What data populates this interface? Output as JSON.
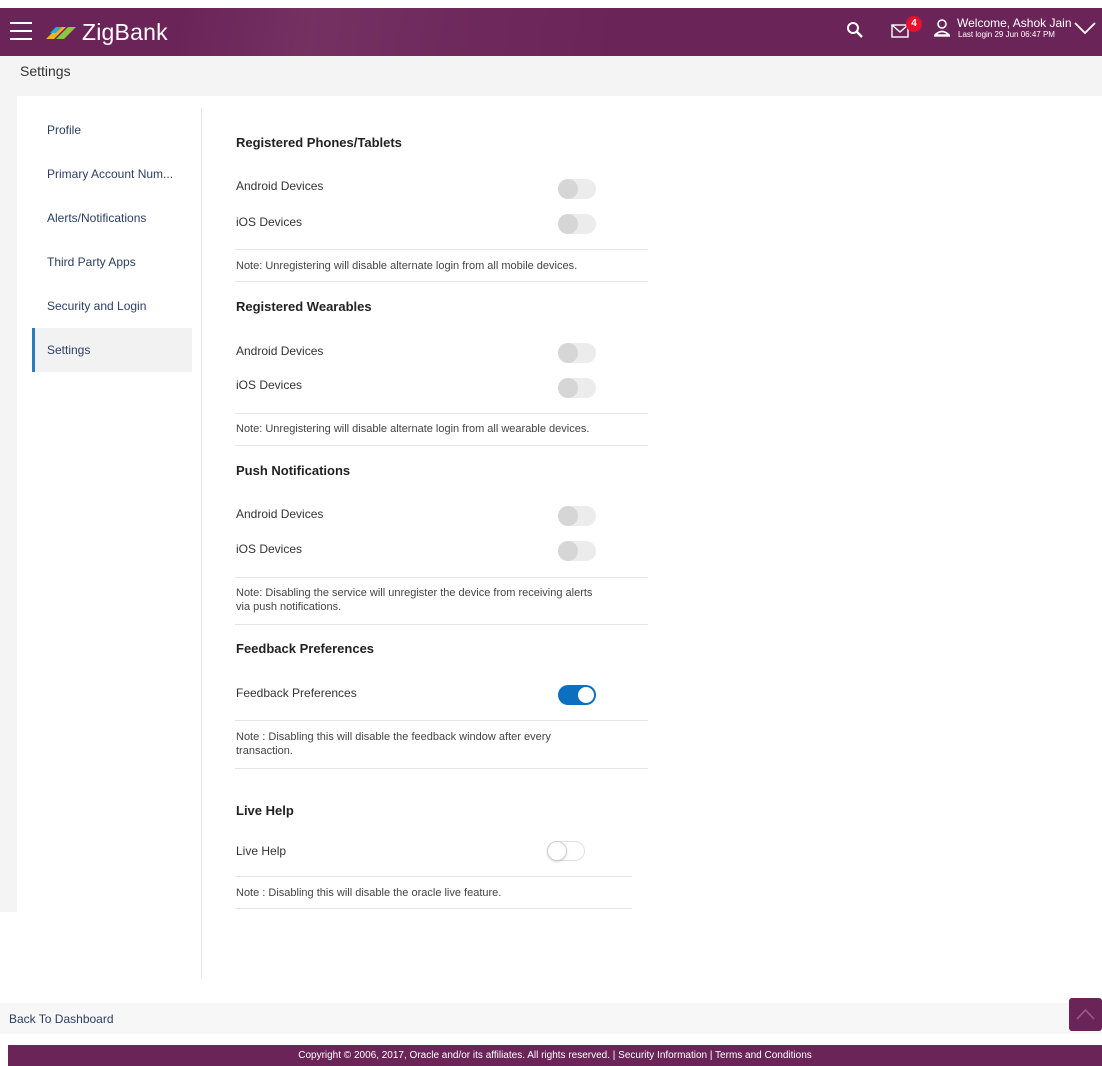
{
  "header": {
    "brand": "ZigBank",
    "notification_count": "4",
    "welcome_text": "Welcome, Ashok Jain",
    "last_login": "Last login 29 Jun 06:47 PM",
    "icons": [
      "menu-icon",
      "search-icon",
      "mail-icon",
      "user-icon",
      "chevron-down-icon"
    ]
  },
  "page": {
    "title": "Settings"
  },
  "sidebar": {
    "items": [
      {
        "label": "Profile",
        "active": false
      },
      {
        "label": "Primary Account Num...",
        "active": false
      },
      {
        "label": "Alerts/Notifications",
        "active": false
      },
      {
        "label": "Third Party Apps",
        "active": false
      },
      {
        "label": "Security and Login",
        "active": false
      },
      {
        "label": "Settings",
        "active": true
      }
    ]
  },
  "sections": {
    "phones": {
      "title": "Registered Phones/Tablets",
      "rows": [
        {
          "label": "Android Devices",
          "enabled": false
        },
        {
          "label": "iOS Devices",
          "enabled": false
        }
      ],
      "note": "Note: Unregistering will disable alternate login from all mobile devices."
    },
    "wearables": {
      "title": "Registered Wearables",
      "rows": [
        {
          "label": "Android Devices",
          "enabled": false
        },
        {
          "label": "iOS Devices",
          "enabled": false
        }
      ],
      "note": "Note: Unregistering will disable alternate login from all wearable devices."
    },
    "push": {
      "title": "Push Notifications",
      "rows": [
        {
          "label": "Android Devices",
          "enabled": false
        },
        {
          "label": "iOS Devices",
          "enabled": false
        }
      ],
      "note_line1": "Note: Disabling the service will unregister the device from receiving alerts",
      "note_line2": "via push notifications."
    },
    "feedback": {
      "title": "Feedback Preferences",
      "rows": [
        {
          "label": "Feedback Preferences",
          "enabled": true
        }
      ],
      "note_line1": "Note : Disabling this will disable the feedback window after every",
      "note_line2": "transaction."
    },
    "livehelp": {
      "title": "Live Help",
      "rows": [
        {
          "label": "Live Help",
          "enabled": false
        }
      ],
      "note": "Note : Disabling this will disable the oracle live feature."
    }
  },
  "footer": {
    "back_link": "Back To Dashboard",
    "copyright": "Copyright © 2006, 2017, Oracle and/or its affiliates. All rights reserved. | Security Information | Terms and Conditions"
  },
  "colors": {
    "brand": "#6b2458",
    "toggle_on": "#0d6fbf",
    "nav_active_border": "#2b7bbf",
    "badge": "#e8112d"
  }
}
